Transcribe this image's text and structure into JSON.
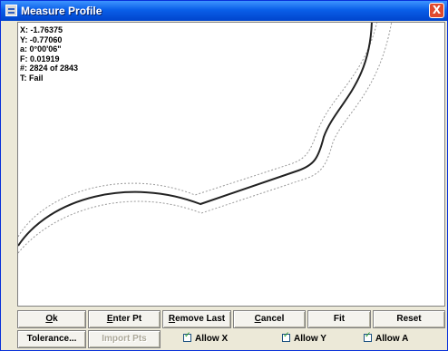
{
  "window": {
    "title": "Measure Profile",
    "close_glyph": "X"
  },
  "readout": {
    "x": "X: -1.76375",
    "y": "Y: -0.77060",
    "a": "a: 0°00'06\"",
    "f": "F: 0.01919",
    "count": "#: 2824 of 2843",
    "t": "T: Fail"
  },
  "buttons_row1": [
    {
      "id": "ok",
      "first": "O",
      "rest": "k"
    },
    {
      "id": "enter-pt",
      "first": "E",
      "rest": "nter Pt"
    },
    {
      "id": "remove-last",
      "first": "R",
      "rest": "emove Last"
    },
    {
      "id": "cancel",
      "first": "C",
      "rest": "ancel"
    },
    {
      "id": "fit",
      "first": "",
      "rest": "Fit"
    },
    {
      "id": "reset",
      "first": "",
      "rest": "Reset"
    }
  ],
  "tolerance_label": "Tolerance...",
  "import_label": "Import Pts",
  "checkboxes": [
    {
      "label": "Allow X",
      "checked": true
    },
    {
      "label": "Allow Y",
      "checked": true
    },
    {
      "label": "Allow A",
      "checked": true
    }
  ],
  "colors": {
    "titlebar": "#0a5fe8",
    "profile_line": "#222222",
    "tolerance_line": "#9a9a9a"
  }
}
